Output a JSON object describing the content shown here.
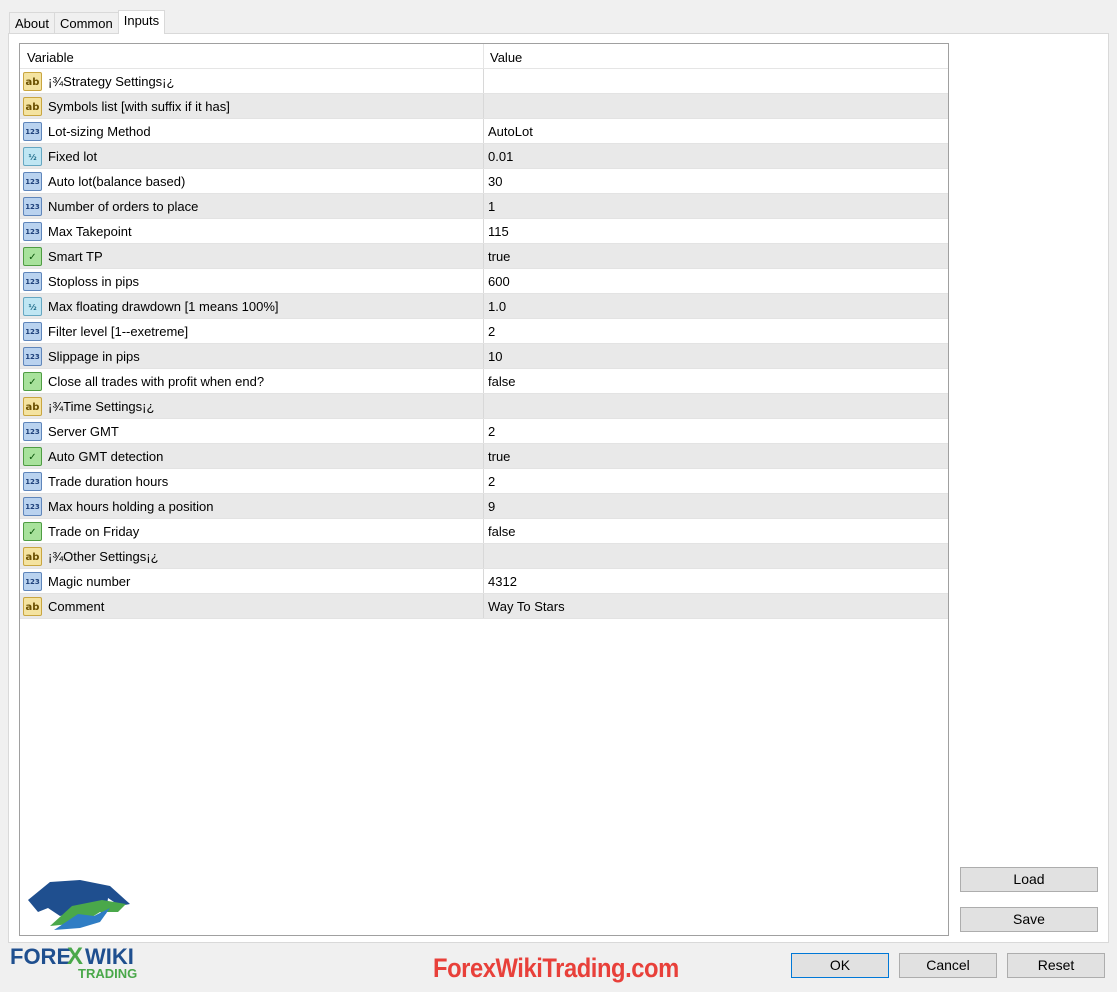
{
  "tabs": [
    "About",
    "Common",
    "Inputs"
  ],
  "columns": {
    "variable": "Variable",
    "value": "Value"
  },
  "rows": [
    {
      "icon": "string-type-icon",
      "type": "str",
      "glyph": "ab",
      "name": "¡¾Strategy Settings¡¿",
      "value": ""
    },
    {
      "icon": "string-type-icon",
      "type": "str",
      "glyph": "ab",
      "name": "Symbols list [with suffix if it has]",
      "value": ""
    },
    {
      "icon": "integer-type-icon",
      "type": "int",
      "glyph": "123",
      "name": "Lot-sizing Method",
      "value": "AutoLot"
    },
    {
      "icon": "double-type-icon",
      "type": "dbl",
      "glyph": "½",
      "name": "Fixed lot",
      "value": "0.01"
    },
    {
      "icon": "integer-type-icon",
      "type": "int",
      "glyph": "123",
      "name": "Auto lot(balance based)",
      "value": "30"
    },
    {
      "icon": "integer-type-icon",
      "type": "int",
      "glyph": "123",
      "name": "Number of orders to place",
      "value": "1"
    },
    {
      "icon": "integer-type-icon",
      "type": "int",
      "glyph": "123",
      "name": "Max Takepoint",
      "value": "115"
    },
    {
      "icon": "bool-type-icon",
      "type": "bool",
      "glyph": "✓",
      "name": "Smart TP",
      "value": "true"
    },
    {
      "icon": "integer-type-icon",
      "type": "int",
      "glyph": "123",
      "name": "Stoploss in pips",
      "value": "600"
    },
    {
      "icon": "double-type-icon",
      "type": "dbl",
      "glyph": "½",
      "name": "Max floating drawdown [1 means 100%]",
      "value": "1.0"
    },
    {
      "icon": "integer-type-icon",
      "type": "int",
      "glyph": "123",
      "name": "Filter level [1--exetreme]",
      "value": "2"
    },
    {
      "icon": "integer-type-icon",
      "type": "int",
      "glyph": "123",
      "name": "Slippage in pips",
      "value": "10"
    },
    {
      "icon": "bool-type-icon",
      "type": "bool",
      "glyph": "✓",
      "name": "Close all trades with profit when end?",
      "value": "false"
    },
    {
      "icon": "string-type-icon",
      "type": "str",
      "glyph": "ab",
      "name": "¡¾Time Settings¡¿",
      "value": ""
    },
    {
      "icon": "integer-type-icon",
      "type": "int",
      "glyph": "123",
      "name": "Server GMT",
      "value": "2"
    },
    {
      "icon": "bool-type-icon",
      "type": "bool",
      "glyph": "✓",
      "name": "Auto GMT detection",
      "value": "true"
    },
    {
      "icon": "integer-type-icon",
      "type": "int",
      "glyph": "123",
      "name": "Trade duration hours",
      "value": "2"
    },
    {
      "icon": "integer-type-icon",
      "type": "int",
      "glyph": "123",
      "name": "Max hours holding a position",
      "value": "9"
    },
    {
      "icon": "bool-type-icon",
      "type": "bool",
      "glyph": "✓",
      "name": "Trade on Friday",
      "value": "false"
    },
    {
      "icon": "string-type-icon",
      "type": "str",
      "glyph": "ab",
      "name": "¡¾Other Settings¡¿",
      "value": ""
    },
    {
      "icon": "integer-type-icon",
      "type": "int",
      "glyph": "123",
      "name": "Magic number",
      "value": "4312"
    },
    {
      "icon": "string-type-icon",
      "type": "str",
      "glyph": "ab",
      "name": "Comment",
      "value": "Way To Stars"
    }
  ],
  "buttons": {
    "load": "Load",
    "save": "Save",
    "ok": "OK",
    "cancel": "Cancel",
    "reset": "Reset"
  },
  "watermark": {
    "site": "ForexWikiTrading.com",
    "logo_text": "FOREX WIKI",
    "logo_sub": "TRADING"
  },
  "colors": {
    "brand_red": "#e8403a",
    "logo_blue": "#1f4f8f",
    "logo_green": "#4aa84a"
  }
}
